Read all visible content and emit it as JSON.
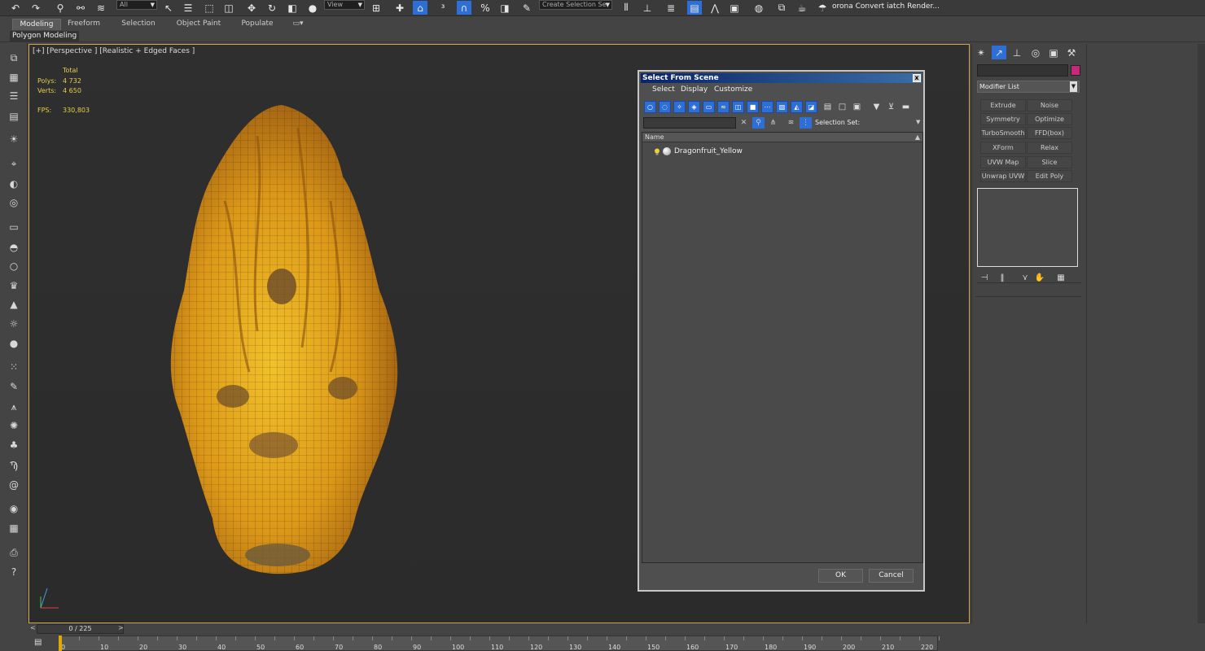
{
  "toolbar": {
    "selection_filter": "All",
    "ref_coord": "View",
    "named_selection": "Create Selection Se",
    "corona_label": "orona Convert iatch Render..."
  },
  "ribbon": {
    "tabs": [
      "Modeling",
      "Freeform",
      "Selection",
      "Object Paint",
      "Populate"
    ],
    "active_tab": "Modeling",
    "sub_label": "Polygon Modeling"
  },
  "viewport": {
    "label": "[+] [Perspective ] [Realistic + Edged Faces ]",
    "stats": {
      "total_label": "Total",
      "polys_label": "Polys:",
      "polys_value": "4 732",
      "verts_label": "Verts:",
      "verts_value": "4 650",
      "fps_label": "FPS:",
      "fps_value": "330,803"
    }
  },
  "dialog": {
    "title": "Select From Scene",
    "close": "x",
    "menu": [
      "Select",
      "Display",
      "Customize"
    ],
    "selection_set_label": "Selection Set:",
    "column_header": "Name",
    "items": [
      {
        "name": "Dragonfruit_Yellow"
      }
    ],
    "ok_label": "OK",
    "cancel_label": "Cancel"
  },
  "command_panel": {
    "modifier_list": "Modifier List",
    "modifiers": [
      [
        "Extrude",
        "Noise"
      ],
      [
        "Symmetry",
        "Optimize"
      ],
      [
        "TurboSmooth",
        "FFD(box)"
      ],
      [
        "XForm",
        "Relax"
      ],
      [
        "UVW Map",
        "Slice"
      ],
      [
        "Unwrap UVW",
        "Edit Poly"
      ]
    ],
    "swatch_color": "#c8287a"
  },
  "timeline": {
    "frame_display": "0 / 225",
    "ticks": [
      "0",
      "10",
      "20",
      "30",
      "40",
      "50",
      "60",
      "70",
      "80",
      "90",
      "100",
      "110",
      "120",
      "130",
      "140",
      "150",
      "160",
      "170",
      "180",
      "190",
      "200",
      "210",
      "220"
    ]
  },
  "colors": {
    "accent": "#2d6fd6",
    "viewport_border": "#d2a54a",
    "stats_text": "#e3d04b"
  }
}
